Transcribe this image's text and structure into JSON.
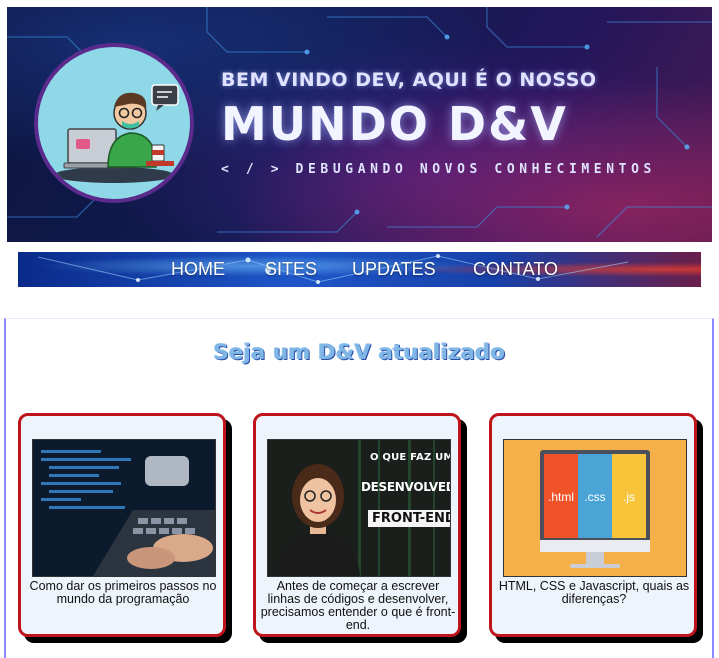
{
  "banner": {
    "welcome": "BEM VINDO DEV, AQUI É O NOSSO",
    "title": "MUNDO D&V",
    "tagline": "< / > DEBUGANDO NOVOS CONHECIMENTOS"
  },
  "nav": {
    "items": [
      {
        "label": "HOME"
      },
      {
        "label": "SITES"
      },
      {
        "label": "UPDATES"
      },
      {
        "label": "CONTATO"
      }
    ]
  },
  "section": {
    "title": "Seja um D&V atualizado"
  },
  "cards": [
    {
      "caption": "Como dar os primeiros passos no mundo da programação"
    },
    {
      "caption": "Antes de começar a escrever linhas de códigos e desenvolver, precisamos entender o que é front-end.",
      "thumb_text": [
        "O QUE FAZ UMA",
        "DESENVOLVEDORA",
        "FRONT-END"
      ]
    },
    {
      "caption": "HTML, CSS e Javascript, quais as diferenças?",
      "thumb_labels": [
        ".html",
        ".css",
        ".js"
      ]
    }
  ],
  "colors": {
    "card_border": "#c0141c",
    "accent_blue": "#7fb6e6",
    "html_orange": "#f0532a",
    "css_blue": "#4aa4d6",
    "js_yellow": "#f7c43a"
  }
}
